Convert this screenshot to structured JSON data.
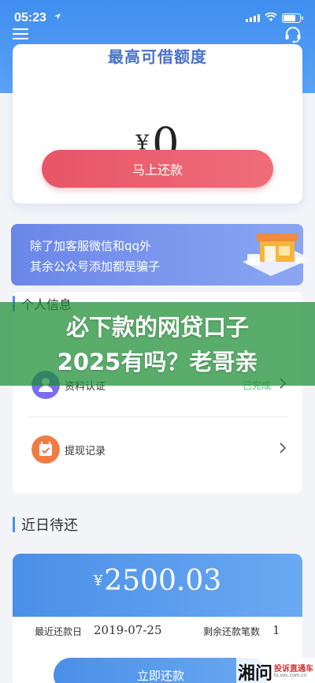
{
  "status_bar": {
    "time": "05:23"
  },
  "credit": {
    "title": "最高可借额度",
    "currency": "¥",
    "amount": "0",
    "repay_button": "马上还款"
  },
  "banner": {
    "line1": "除了加客服微信和qq外",
    "line2": "其余公众号添加都是骗子"
  },
  "personal_info": {
    "title": "个人信息",
    "items": [
      {
        "label": "资料认证",
        "status": "已完成",
        "icon": "user-verify-icon"
      },
      {
        "label": "提现记录",
        "status": "",
        "icon": "calendar-record-icon"
      }
    ]
  },
  "overlay": {
    "line1": "必下款的网贷口子",
    "line2": "2025有吗？老哥亲"
  },
  "recent": {
    "title": "近日待还",
    "currency": "¥",
    "amount": "2500.03",
    "due_label": "最近还款日",
    "due_date": "2019-07-25",
    "remain_label": "剩余还款笔数",
    "remain_count": "1",
    "pay_button": "立即还款"
  },
  "watermark": {
    "main": "湘问",
    "sub1": "投诉直通车",
    "sub2": "ts.voc.com.cn"
  },
  "colors": {
    "primary_blue": "#4a8fe8",
    "repay_red": "#e85566",
    "success_green": "#4cc86f",
    "overlay_green": "#1b8c32"
  }
}
